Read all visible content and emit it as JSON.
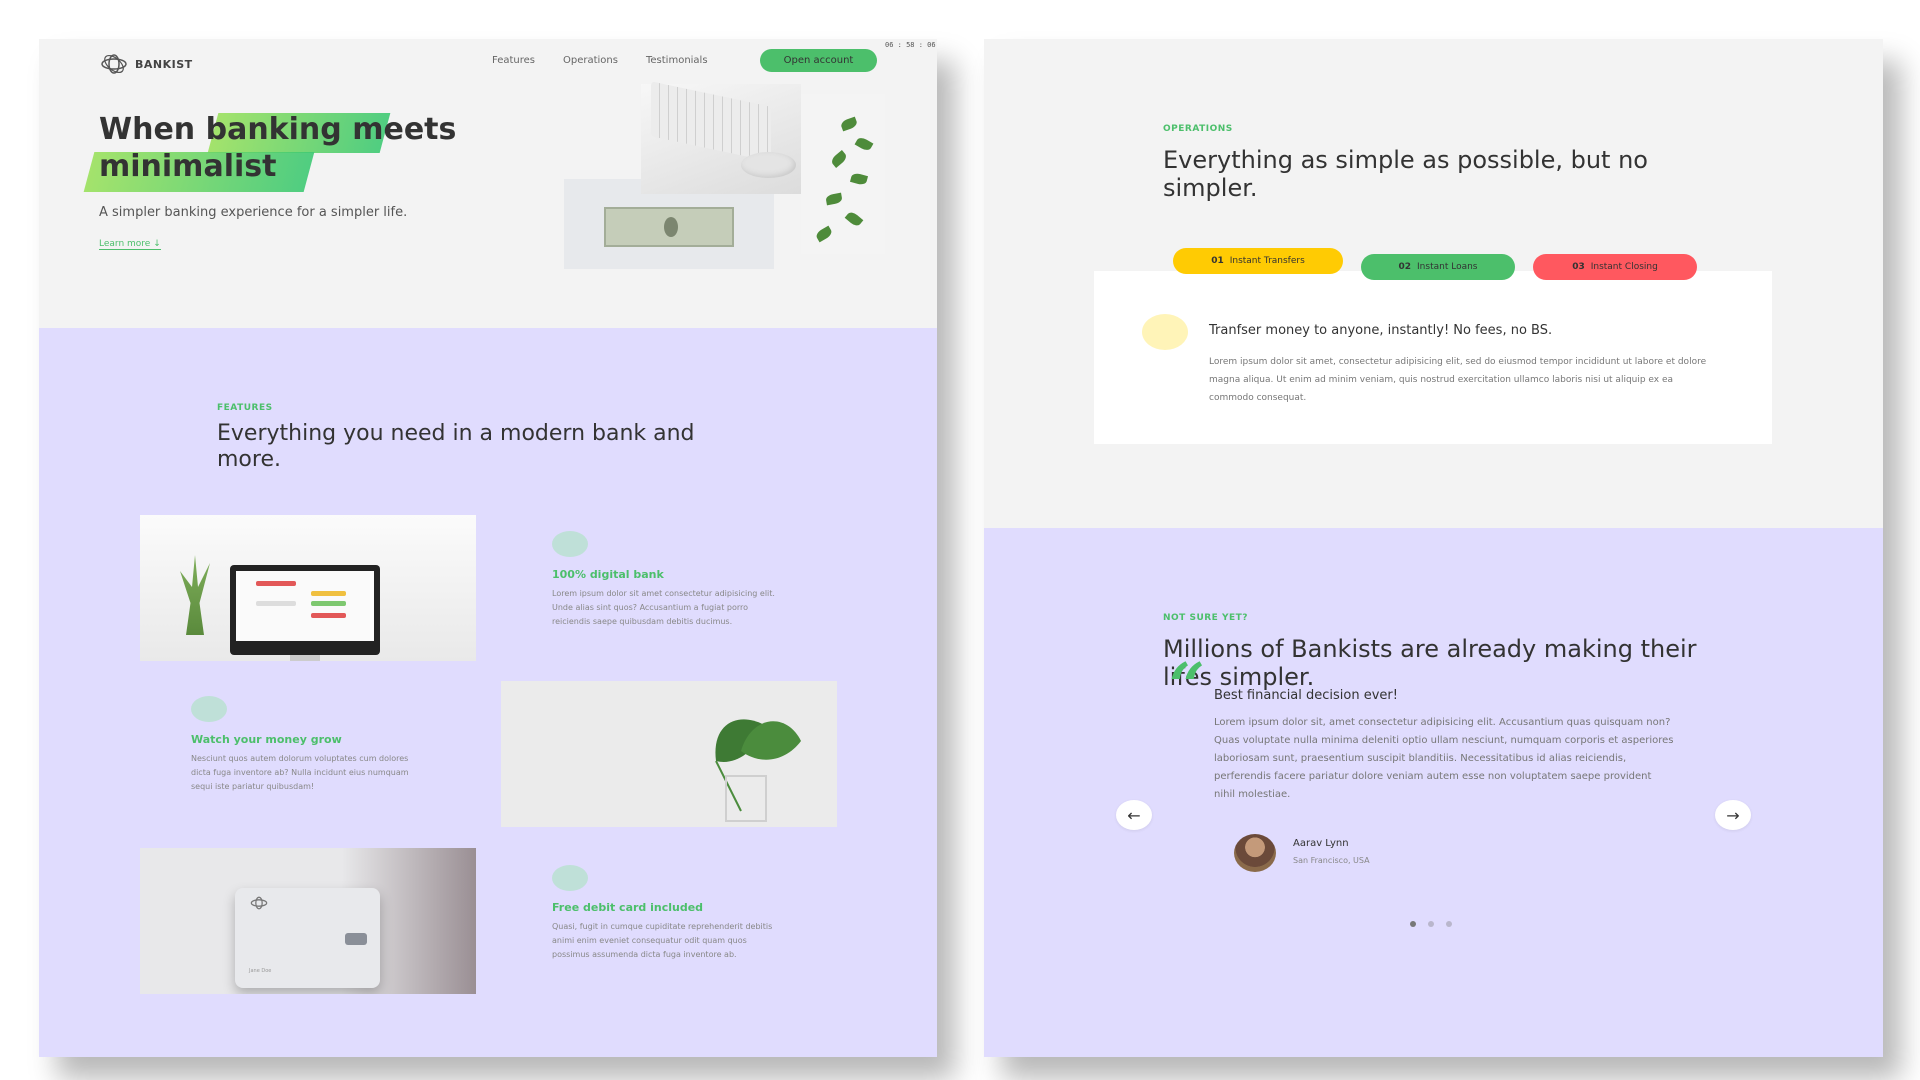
{
  "nav": {
    "logo_text": "BANKIST",
    "links": [
      "Features",
      "Operations",
      "Testimonials"
    ],
    "cta": "Open account",
    "timer": "06 : 58 : 06"
  },
  "hero": {
    "title_part1": "When ",
    "title_highlight1": "banking",
    "title_part2": " meets",
    "title_highlight2": "minimalist",
    "subtitle": "A simpler banking experience for a simpler life.",
    "learn_more": "Learn more ↓"
  },
  "features": {
    "tag": "FEATURES",
    "title": "Everything you need in a modern bank and more.",
    "items": [
      {
        "heading": "100% digital bank",
        "body": "Lorem ipsum dolor sit amet consectetur adipisicing elit. Unde alias sint quos? Accusantium a fugiat porro reiciendis saepe quibusdam debitis ducimus."
      },
      {
        "heading": "Watch your money grow",
        "body": "Nesciunt quos autem dolorum voluptates cum dolores dicta fuga inventore ab? Nulla incidunt eius numquam sequi iste pariatur quibusdam!"
      },
      {
        "heading": "Free debit card included",
        "body": "Quasi, fugit in cumque cupiditate reprehenderit debitis animi enim eveniet consequatur odit quam quos possimus assumenda dicta fuga inventore ab."
      }
    ],
    "card_name": "Jane Doe"
  },
  "operations": {
    "tag": "OPERATIONS",
    "title": "Everything as simple as possible, but no simpler.",
    "tabs": [
      {
        "num": "01",
        "label": "Instant Transfers",
        "color": "#ffcb03"
      },
      {
        "num": "02",
        "label": "Instant Loans",
        "color": "#4cbf6b"
      },
      {
        "num": "03",
        "label": "Instant Closing",
        "color": "#ff585f"
      }
    ],
    "content_title": "Tranfser money to anyone, instantly! No fees, no BS.",
    "content_body": "Lorem ipsum dolor sit amet, consectetur adipisicing elit, sed do eiusmod tempor incididunt ut labore et dolore magna aliqua. Ut enim ad minim veniam, quis nostrud exercitation ullamco laboris nisi ut aliquip ex ea commodo consequat."
  },
  "testimonials": {
    "tag": "NOT SURE YET?",
    "title": "Millions of Bankists are already making their lifes simpler.",
    "quote_mark": "“",
    "quote_title": "Best financial decision ever!",
    "quote_body": "Lorem ipsum dolor sit, amet consectetur adipisicing elit. Accusantium quas quisquam non? Quas voluptate nulla minima deleniti optio ullam nesciunt, numquam corporis et asperiores laboriosam sunt, praesentium suscipit blanditiis. Necessitatibus id alias reiciendis, perferendis facere pariatur dolore veniam autem esse non voluptatem saepe provident nihil molestiae.",
    "author_name": "Aarav Lynn",
    "author_location": "San Francisco, USA",
    "prev_arrow": "←",
    "next_arrow": "→",
    "slides": 3,
    "active_slide": 1
  },
  "colors": {
    "accent_green": "#4cbf6b",
    "section_purple": "#e0dcfe",
    "yellow": "#ffcb03",
    "red": "#ff585f"
  }
}
